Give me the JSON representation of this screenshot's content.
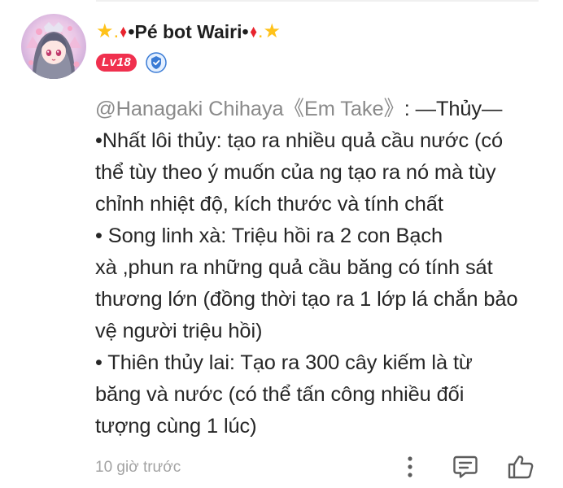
{
  "user": {
    "nickname_prefix": "★.",
    "nickname_diamond": "♦",
    "nickname_core": "•Pé bot Wairi•",
    "nickname_suffix_diamond": "♦",
    "nickname_suffix": ".★",
    "level": "Lv18",
    "avatar_icon": "anime-girl-avatar",
    "badge_icon": "verified-shield-icon"
  },
  "comment": {
    "mention": "@Hanagaki Chihaya《Em Take》",
    "lines": [
      ": —Thủy—",
      "•Nhất lôi thủy: tạo ra nhiều quả cầu nước (có",
      "thể tùy theo ý muốn của ng tạo ra nó mà tùy",
      "chỉnh nhiệt độ, kích thước và tính chất",
      "• Song linh xà: Triệu hồi ra 2 con Bạch",
      "xà ,phun ra những quả cầu băng có tính sát",
      "thương lớn (đồng thời tạo ra 1 lớp lá chắn bảo",
      "vệ người triệu hồi)",
      "• Thiên thủy lai: Tạo ra 300 cây kiếm là từ",
      "băng và nước (có thể tấn công nhiều đối",
      "tượng cùng 1 lúc)"
    ]
  },
  "footer": {
    "timestamp": "10 giờ trước",
    "more_icon": "more-vertical-icon",
    "reply_icon": "comment-icon",
    "like_icon": "thumbs-up-icon"
  },
  "colors": {
    "level_badge": "#f0304e",
    "star": "#ffc21a",
    "diamond": "#e8242e",
    "verified": "#3a7bd5",
    "mention": "#8a8a8a",
    "timestamp": "#a3a3a3"
  }
}
